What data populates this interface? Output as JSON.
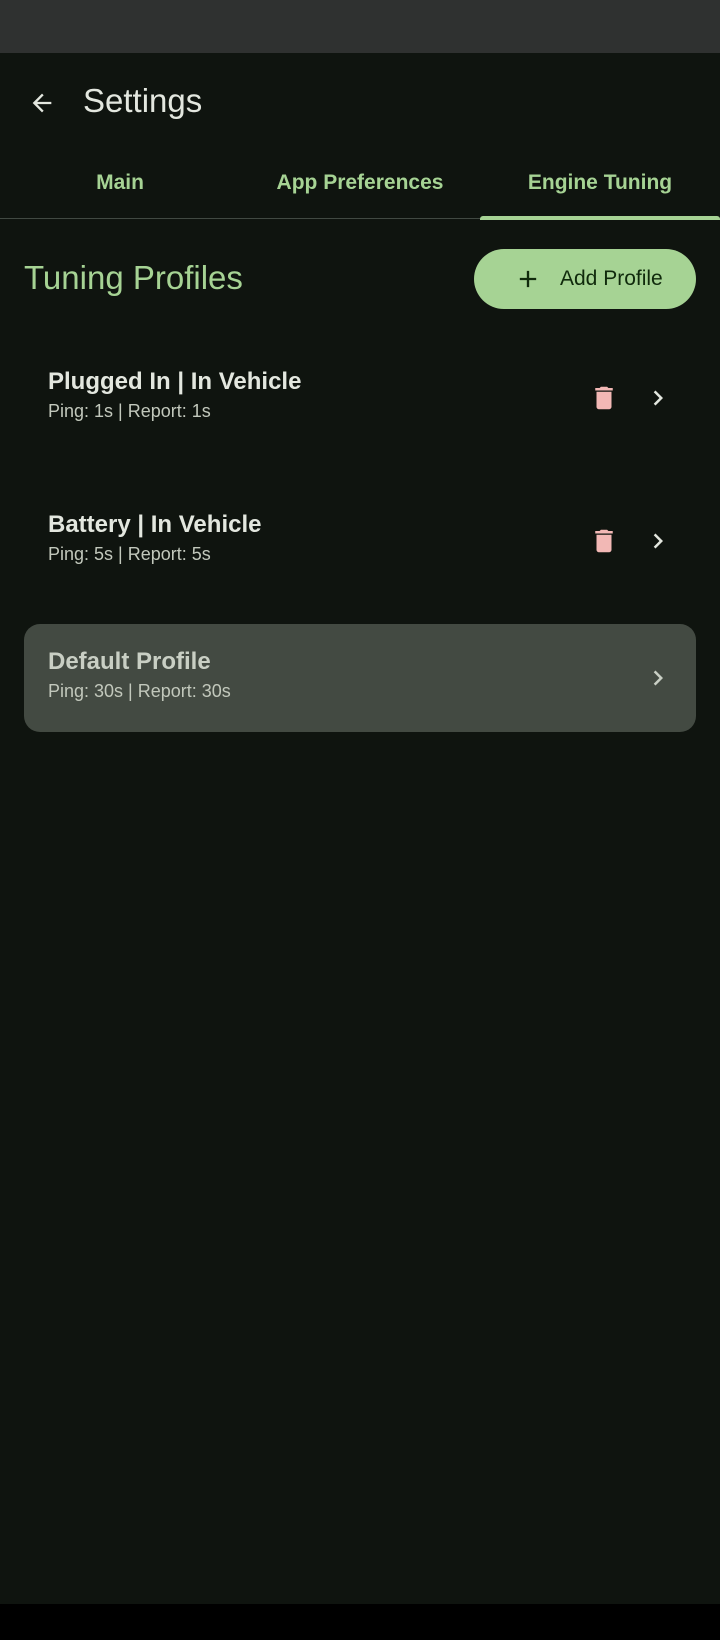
{
  "colors": {
    "background": "#0f140f",
    "accent": "#a6d394",
    "delete": "#f2b8b5",
    "card_default": "#434a42"
  },
  "app_bar": {
    "title": "Settings",
    "back_icon": "arrow-back-icon"
  },
  "tabs": [
    {
      "label": "Main",
      "active": false
    },
    {
      "label": "App Preferences",
      "active": false
    },
    {
      "label": "Engine Tuning",
      "active": true
    }
  ],
  "section": {
    "title": "Tuning Profiles",
    "add_button": {
      "label": "Add Profile",
      "icon": "plus-icon"
    }
  },
  "profiles": [
    {
      "name": "Plugged In | In Vehicle",
      "details": "Ping: 1s | Report: 1s",
      "deletable": true
    },
    {
      "name": "Battery | In Vehicle",
      "details": "Ping: 5s | Report: 5s",
      "deletable": true
    },
    {
      "name": "Default Profile",
      "details": "Ping: 30s | Report: 30s",
      "deletable": false
    }
  ]
}
